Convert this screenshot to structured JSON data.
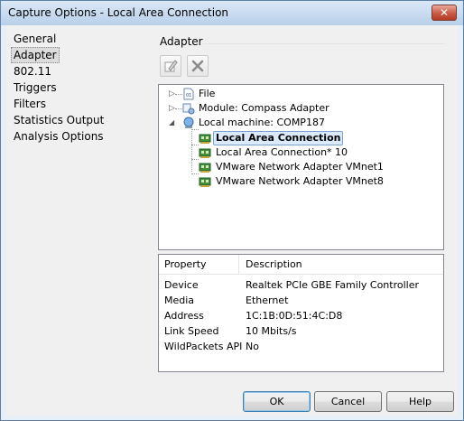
{
  "window": {
    "title": "Capture Options - Local Area Connection",
    "close_label": "✕"
  },
  "nav": {
    "items": [
      {
        "label": "General",
        "selected": false
      },
      {
        "label": "Adapter",
        "selected": true
      },
      {
        "label": "802.11",
        "selected": false
      },
      {
        "label": "Triggers",
        "selected": false
      },
      {
        "label": "Filters",
        "selected": false
      },
      {
        "label": "Statistics Output",
        "selected": false
      },
      {
        "label": "Analysis Options",
        "selected": false
      }
    ]
  },
  "adapter": {
    "section_title": "Adapter",
    "toolbar": {
      "edit_icon": "edit-icon",
      "delete_icon": "delete-icon"
    },
    "tree": {
      "file": "File",
      "module": "Module: Compass Adapter",
      "local_machine": "Local machine: COMP187",
      "adapters": [
        {
          "label": "Local Area Connection",
          "selected": true
        },
        {
          "label": "Local Area Connection* 10",
          "selected": false
        },
        {
          "label": "VMware Network Adapter VMnet1",
          "selected": false
        },
        {
          "label": "VMware Network Adapter VMnet8",
          "selected": false
        }
      ]
    },
    "properties": {
      "headers": {
        "property": "Property",
        "description": "Description"
      },
      "rows": [
        {
          "key": "Device",
          "value": "Realtek PCIe GBE Family Controller"
        },
        {
          "key": "Media",
          "value": "Ethernet"
        },
        {
          "key": "Address",
          "value": "1C:1B:0D:51:4C:D8"
        },
        {
          "key": "Link Speed",
          "value": "10 Mbits/s"
        },
        {
          "key": "WildPackets API",
          "value": "No"
        }
      ]
    }
  },
  "buttons": {
    "ok": "OK",
    "cancel": "Cancel",
    "help": "Help"
  }
}
